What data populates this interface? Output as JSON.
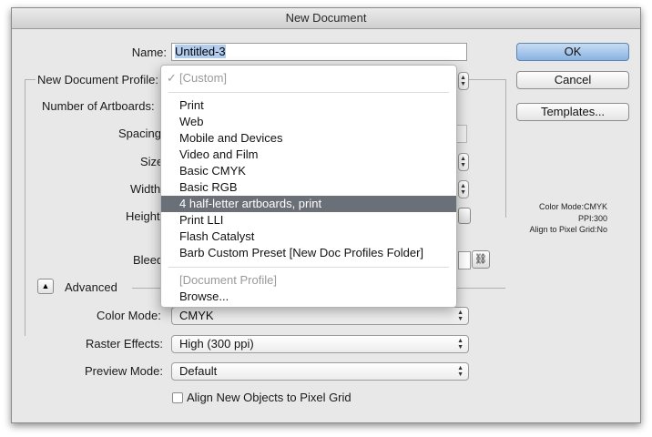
{
  "window": {
    "title": "New Document"
  },
  "name": {
    "label": "Name:",
    "value": "Untitled-3"
  },
  "profile": {
    "label": "New Document Profile:"
  },
  "artboards": {
    "label": "Number of Artboards:"
  },
  "spacing": {
    "label": "Spacing:"
  },
  "size": {
    "label": "Size:"
  },
  "width": {
    "label": "Width:"
  },
  "height": {
    "label": "Height:"
  },
  "bleed": {
    "label": "Bleed:"
  },
  "advanced": {
    "label": "Advanced",
    "toggle_glyph": "▲"
  },
  "color_mode": {
    "label": "Color Mode:",
    "value": "CMYK"
  },
  "raster_effects": {
    "label": "Raster Effects:",
    "value": "High (300 ppi)"
  },
  "preview_mode": {
    "label": "Preview Mode:",
    "value": "Default"
  },
  "align_pixel": {
    "label": "Align New Objects to Pixel Grid",
    "checked": false
  },
  "buttons": {
    "ok": "OK",
    "cancel": "Cancel",
    "templates": "Templates..."
  },
  "info": {
    "color_mode": "Color Mode:CMYK",
    "ppi": "PPI:300",
    "align": "Align to Pixel Grid:No"
  },
  "menu": {
    "custom": "[Custom]",
    "checkmark": "✓",
    "items": [
      "Print",
      "Web",
      "Mobile and Devices",
      "Video and Film",
      "Basic CMYK",
      "Basic RGB",
      "4 half-letter artboards, print",
      "Print LLI",
      "Flash Catalyst",
      "Barb Custom Preset [New Doc Profiles Folder]"
    ],
    "highlighted_index": 6,
    "document_profile": "[Document Profile]",
    "browse": "Browse..."
  },
  "icons": {
    "updown": "updown-arrows-icon",
    "link": "link-icon"
  }
}
